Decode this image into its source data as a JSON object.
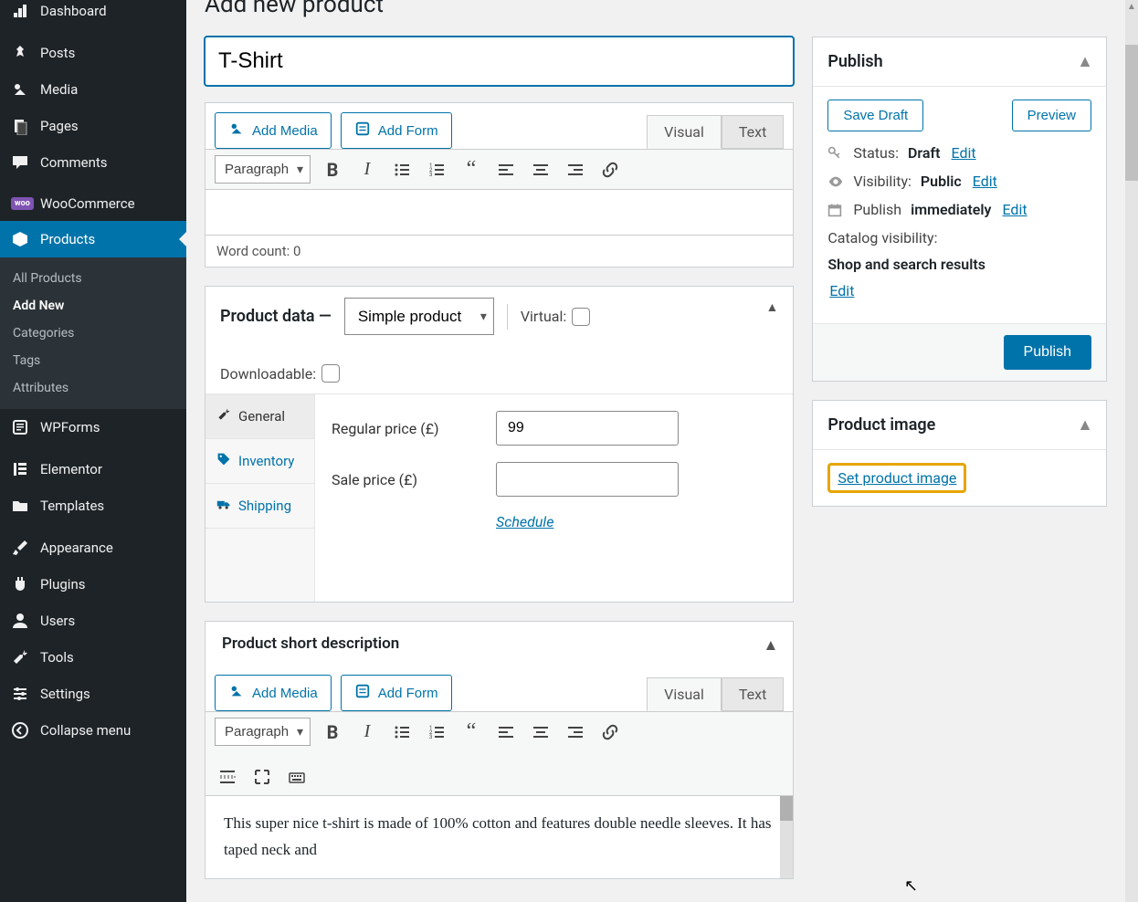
{
  "page_title": "Add new product",
  "sidebar": {
    "items": [
      {
        "label": "Dashboard"
      },
      {
        "label": "Posts"
      },
      {
        "label": "Media"
      },
      {
        "label": "Pages"
      },
      {
        "label": "Comments"
      },
      {
        "label": "WooCommerce"
      },
      {
        "label": "Products"
      },
      {
        "label": "WPForms"
      },
      {
        "label": "Elementor"
      },
      {
        "label": "Templates"
      },
      {
        "label": "Appearance"
      },
      {
        "label": "Plugins"
      },
      {
        "label": "Users"
      },
      {
        "label": "Tools"
      },
      {
        "label": "Settings"
      },
      {
        "label": "Collapse menu"
      }
    ],
    "submenu": {
      "items": [
        "All Products",
        "Add New",
        "Categories",
        "Tags",
        "Attributes"
      ]
    }
  },
  "product": {
    "title_value": "T-Shirt",
    "regular_price": "99",
    "sale_price": ""
  },
  "editor": {
    "add_media": "Add Media",
    "add_form": "Add Form",
    "tab_visual": "Visual",
    "tab_text": "Text",
    "format": "Paragraph",
    "word_count": "Word count: 0"
  },
  "product_data": {
    "title": "Product data —",
    "type_select": "Simple product",
    "virtual": "Virtual:",
    "downloadable": "Downloadable:",
    "tabs": {
      "general": "General",
      "inventory": "Inventory",
      "shipping": "Shipping"
    },
    "regular_label": "Regular price (£)",
    "sale_label": "Sale price (£)",
    "schedule": "Schedule"
  },
  "short_desc": {
    "title": "Product short description",
    "content": "This super nice t-shirt is made of 100% cotton and features double needle sleeves. It has taped neck and"
  },
  "publish": {
    "title": "Publish",
    "save_draft": "Save Draft",
    "preview": "Preview",
    "status_label": "Status:",
    "status_value": "Draft",
    "visibility_label": "Visibility:",
    "visibility_value": "Public",
    "publish_label": "Publish",
    "publish_value": "immediately",
    "catalog_label": "Catalog visibility:",
    "catalog_value": "Shop and search results",
    "edit": "Edit",
    "publish_btn": "Publish"
  },
  "product_image": {
    "title": "Product image",
    "set_link": "Set product image"
  }
}
